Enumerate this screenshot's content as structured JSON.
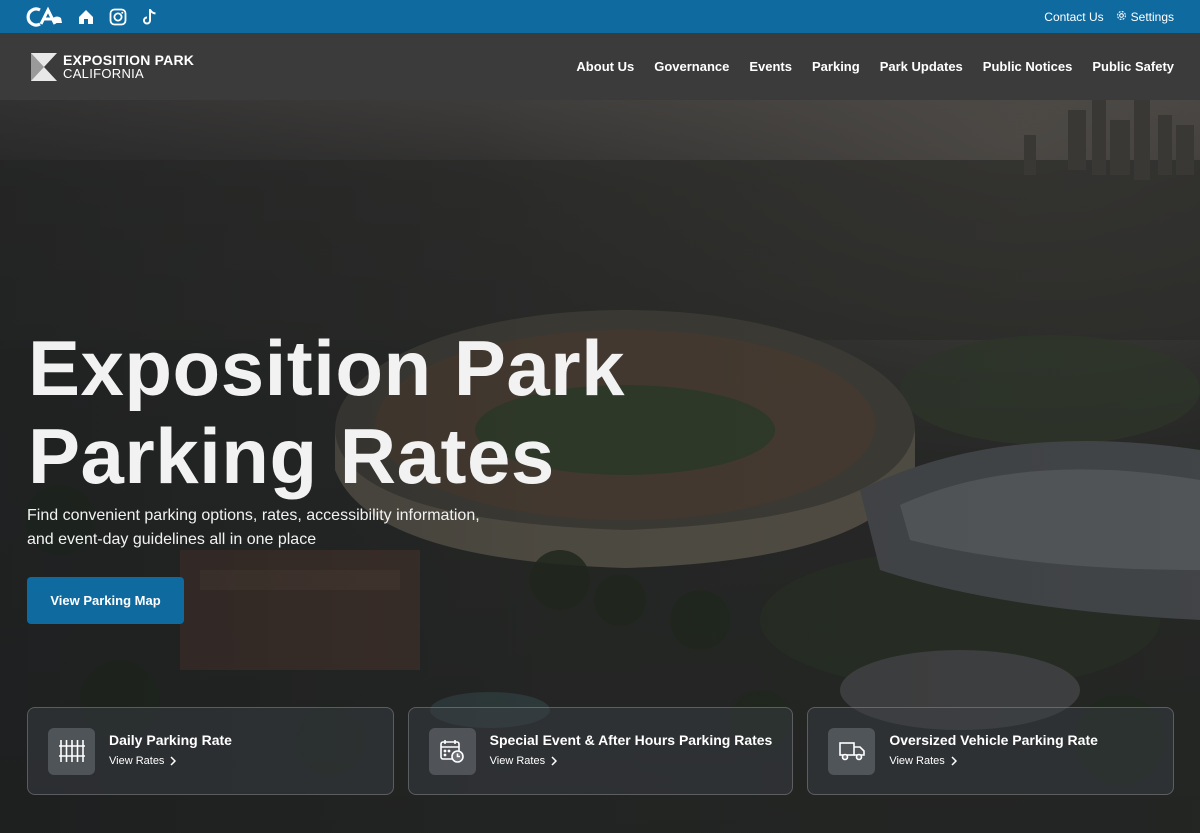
{
  "utility": {
    "logo": "CA",
    "icons": [
      "home-icon",
      "instagram-icon",
      "tiktok-icon"
    ],
    "contact": "Contact Us",
    "settings": "Settings",
    "bg_color": "#0f6aa0"
  },
  "header": {
    "brand_line1": "EXPOSITION PARK",
    "brand_line2": "CALIFORNIA",
    "nav": [
      "About Us",
      "Governance",
      "Events",
      "Parking",
      "Park Updates",
      "Public Notices",
      "Public Safety"
    ],
    "bg_color": "#3b3b3b"
  },
  "hero": {
    "title_line1": "Exposition Park",
    "title_line2": "Parking Rates",
    "subtitle_line1": "Find convenient parking options, rates, accessibility information,",
    "subtitle_line2": "and event-day guidelines all in one place",
    "button": "View Parking Map",
    "accent_color": "#0f6aa0"
  },
  "cards": [
    {
      "title": "Daily Parking Rate",
      "link": "View Rates",
      "icon": "parking-grid-icon"
    },
    {
      "title": "Special Event & After Hours Parking Rates",
      "link": "View Rates",
      "icon": "calendar-clock-icon"
    },
    {
      "title": "Oversized Vehicle Parking Rate",
      "link": "View Rates",
      "icon": "truck-icon"
    }
  ]
}
